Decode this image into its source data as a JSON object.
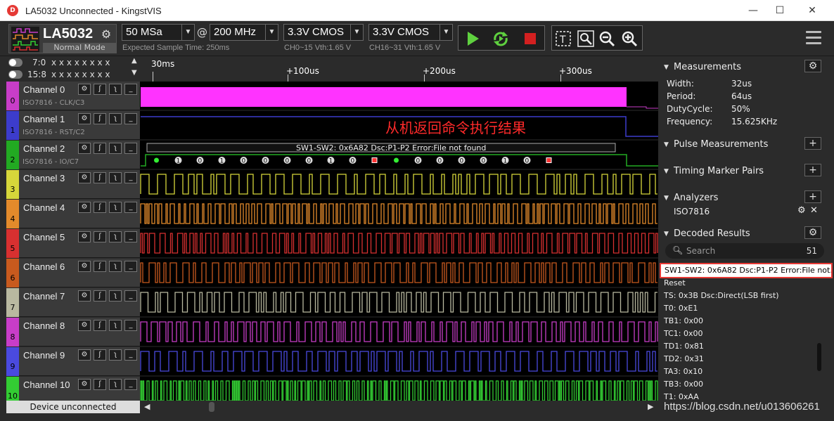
{
  "window": {
    "title": "LA5032 Unconnected - KingstVIS",
    "icon_text": "D",
    "minimize": "—",
    "maximize": "☐",
    "close": "✕"
  },
  "toolbar": {
    "device_name": "LA5032",
    "device_mode": "Normal Mode",
    "sample_depth": "50 MSa",
    "at": "@",
    "sample_rate": "200 MHz",
    "threshold1": "3.3V CMOS",
    "threshold2": "3.3V CMOS",
    "expected_time": "Expected Sample Time: 250ms",
    "th1_info": "CH0~15 Vth:1.65 V",
    "th2_info": "CH16~31 Vth:1.65 V",
    "start_icon": "play-icon",
    "loop_icon": "loop-icon",
    "stop_icon": "stop-icon"
  },
  "toggles": [
    {
      "label": "7:0",
      "bits": "x x x x x x x x",
      "arrow": "▲"
    },
    {
      "label": "15:8",
      "bits": "x x x x x x x x",
      "arrow": "▼"
    }
  ],
  "channels": [
    {
      "index": "0",
      "name": "Channel 0",
      "sub": "ISO7816 - CLK/C3",
      "color": "#c83dc8"
    },
    {
      "index": "1",
      "name": "Channel 1",
      "sub": "ISO7816 - RST/C2",
      "color": "#3c3ccc"
    },
    {
      "index": "2",
      "name": "Channel 2",
      "sub": "ISO7816 - IO/C7",
      "color": "#22aa22"
    },
    {
      "index": "3",
      "name": "Channel 3",
      "sub": "",
      "color": "#d6d63a"
    },
    {
      "index": "4",
      "name": "Channel 4",
      "sub": "",
      "color": "#e38a2b"
    },
    {
      "index": "5",
      "name": "Channel 5",
      "sub": "",
      "color": "#d83030"
    },
    {
      "index": "6",
      "name": "Channel 6",
      "sub": "",
      "color": "#c85a1e"
    },
    {
      "index": "7",
      "name": "Channel 7",
      "sub": "",
      "color": "#b9b9a0"
    },
    {
      "index": "8",
      "name": "Channel 8",
      "sub": "",
      "color": "#c83dc8"
    },
    {
      "index": "9",
      "name": "Channel 9",
      "sub": "",
      "color": "#4a4adf"
    },
    {
      "index": "10",
      "name": "Channel 10",
      "sub": "",
      "color": "#33cc33"
    }
  ],
  "device_status": "Device unconnected",
  "ruler": {
    "labels": [
      "30ms",
      "+100us",
      "+200us",
      "+300us"
    ]
  },
  "annotation": "从机返回命令执行结果",
  "ch2_decode_label": "SW1-SW2: 0x6A82 Dsc:P1-P2 Error:File not found",
  "ch2_bits": [
    "0",
    "1",
    "0",
    "1",
    "0",
    "0",
    "0",
    "0",
    "1",
    "0",
    "1",
    "0",
    "0",
    "0",
    "0",
    "0",
    "1",
    "0",
    "0"
  ],
  "right": {
    "measurements": {
      "title": "Measurements",
      "rows": [
        {
          "k": "Width:",
          "v": "32us"
        },
        {
          "k": "Period:",
          "v": "64us"
        },
        {
          "k": "DutyCycle:",
          "v": "50%"
        },
        {
          "k": "Frequency:",
          "v": "15.625KHz"
        }
      ]
    },
    "pulse": "Pulse Measurements",
    "timing": "Timing Marker Pairs",
    "analyzers": {
      "title": "Analyzers",
      "item": "ISO7816"
    },
    "decoded": {
      "title": "Decoded Results",
      "search_placeholder": "Search",
      "count": "51",
      "selected": "SW1-SW2: 0x6A82 Dsc:P1-P2 Error:File not...",
      "items": [
        "Reset",
        "TS: 0x3B Dsc:Direct(LSB first)",
        "T0: 0xE1",
        "TB1: 0x00",
        "TC1: 0x00",
        "TD1: 0x81",
        "TD2: 0x31",
        "TA3: 0x10",
        "TB3: 0x00",
        "T1: 0xAA"
      ]
    }
  },
  "watermark": "https://blog.csdn.net/u013606261",
  "colors": {
    "accent_green": "#5fd13f",
    "stop_red": "#d32020",
    "highlight_red": "#e53935"
  }
}
